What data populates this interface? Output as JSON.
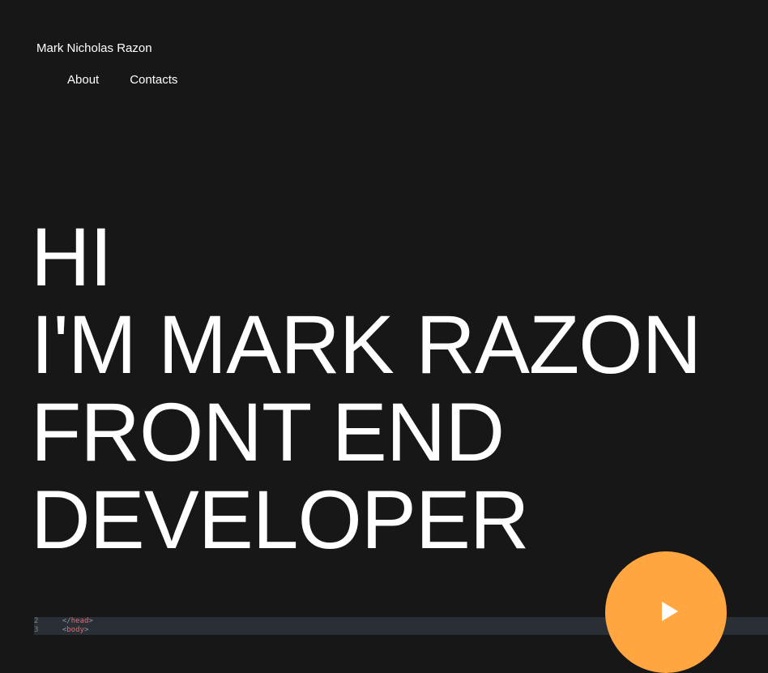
{
  "header": {
    "site_name": "Mark Nicholas Razon"
  },
  "nav": {
    "items": [
      {
        "label": "About"
      },
      {
        "label": "Contacts"
      }
    ]
  },
  "hero": {
    "lines": [
      "HI",
      "I'M MARK RAZON",
      "FRONT END",
      "DEVELOPER"
    ]
  },
  "code_preview": {
    "lines": [
      {
        "num": "2",
        "indent": "  ",
        "open": "</",
        "tag": "head",
        "close": ">"
      },
      {
        "num": "3",
        "indent": "  ",
        "open": "<",
        "tag": "body",
        "close": ">"
      }
    ]
  },
  "play_button": {
    "icon": "play-icon",
    "color": "#ffa640"
  },
  "colors": {
    "background": "#171717",
    "text": "#ffffff",
    "accent": "#ffa640",
    "code_background": "#2a2f36",
    "code_tag": "#e06c75"
  }
}
